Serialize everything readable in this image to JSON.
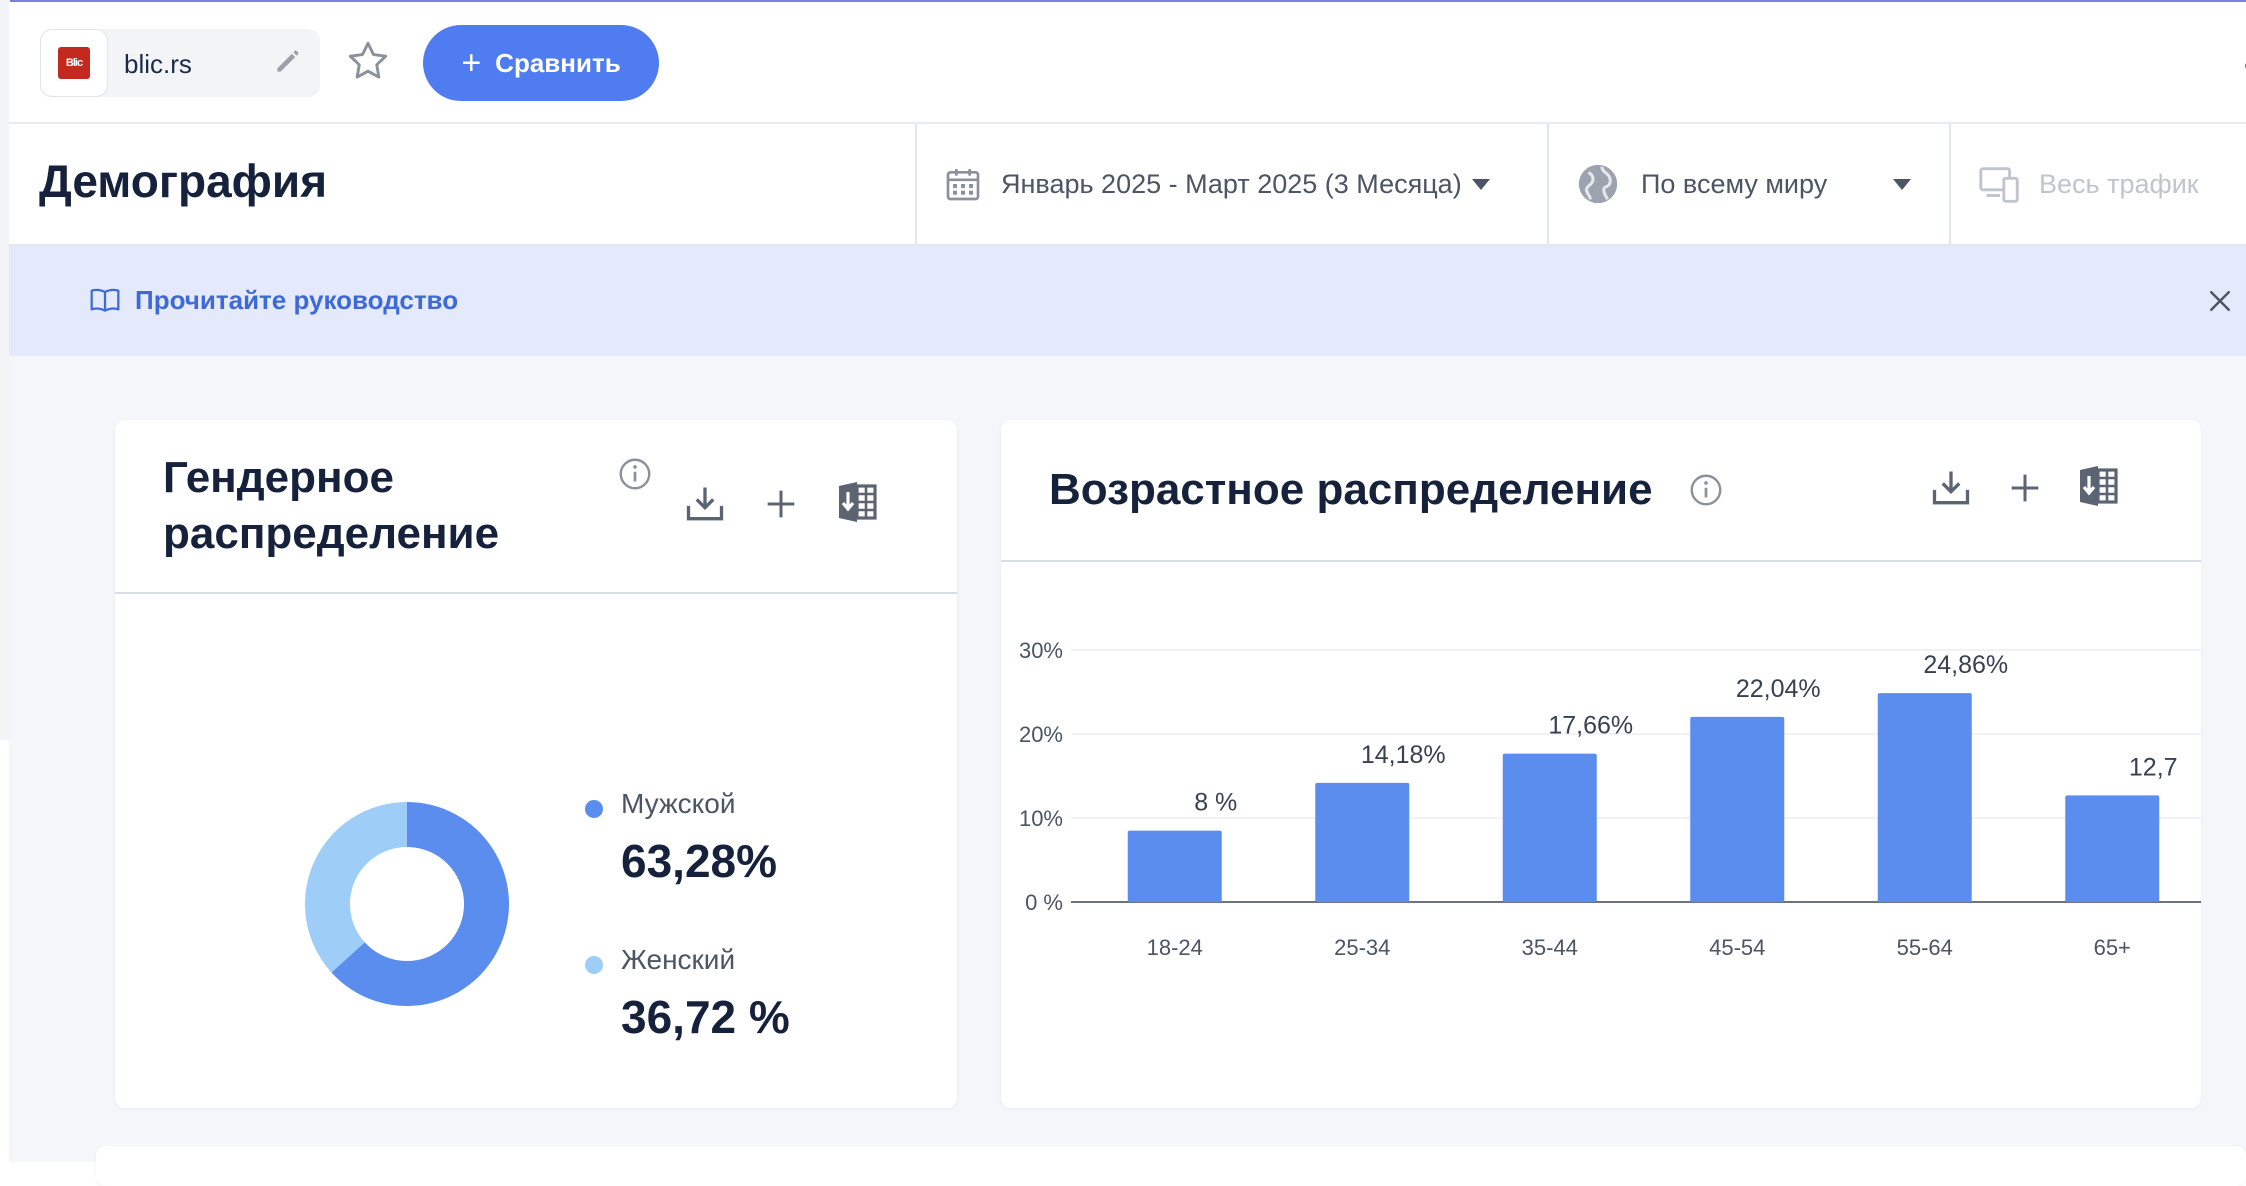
{
  "site": {
    "name": "blic.rs",
    "logo_text": "Blic"
  },
  "toolbar": {
    "compare_label": "Сравнить"
  },
  "header": {
    "title": "Демография",
    "date_range": "Январь 2025 - Март 2025 (3 Месяца)",
    "region": "По всему миру",
    "traffic": "Весь трафик"
  },
  "banner": {
    "guide_label": "Прочитайте руководство"
  },
  "gender": {
    "title_line1": "Гендерное",
    "title_line2": "распределение",
    "items": [
      {
        "label": "Мужской",
        "value_text": "63,28%",
        "value": 63.28,
        "color": "#5b8def"
      },
      {
        "label": "Женский",
        "value_text": "36,72 %",
        "value": 36.72,
        "color": "#9ecdf7"
      }
    ]
  },
  "age": {
    "title": "Возрастное распределение"
  },
  "chart_data": {
    "type": "bar",
    "categories": [
      "18-24",
      "25-34",
      "35-44",
      "45-54",
      "55-64",
      "65+"
    ],
    "values": [
      8.5,
      14.18,
      17.66,
      22.04,
      24.86,
      12.7
    ],
    "data_labels": [
      "8 %",
      "14,18%",
      "17,66%",
      "22,04%",
      "24,86%",
      "12,7"
    ],
    "yticks": [
      "0 %",
      "10%",
      "20%",
      "30%"
    ],
    "ylim": [
      0,
      30
    ],
    "color": "#5b8def",
    "grid": true
  }
}
